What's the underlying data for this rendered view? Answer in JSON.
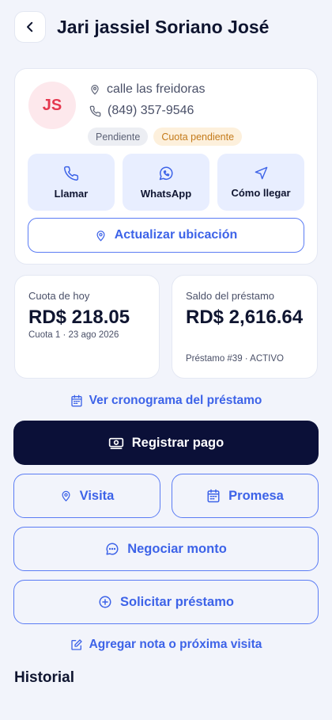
{
  "header": {
    "title": "Jari jassiel Soriano José"
  },
  "client": {
    "initials": "JS",
    "address": "calle las freidoras",
    "phone": "(849) 357-9546",
    "badges": [
      "Pendiente",
      "Cuota pendiente"
    ]
  },
  "actions": [
    {
      "label": "Llamar",
      "icon": "phone-icon"
    },
    {
      "label": "WhatsApp",
      "icon": "whatsapp-icon"
    },
    {
      "label": "Cómo llegar",
      "icon": "navigation-icon"
    }
  ],
  "update_location_label": "Actualizar ubicación",
  "today_installment": {
    "label": "Cuota de hoy",
    "value": "RD$ 218.05",
    "sub": "Cuota 1 · 23 ago 2026"
  },
  "loan_balance": {
    "label": "Saldo del préstamo",
    "value": "RD$ 2,616.64",
    "sub": "Préstamo #39 · ACTIVO"
  },
  "schedule_link": "Ver cronograma del préstamo",
  "buttons": {
    "register_payment": "Registrar pago",
    "visit": "Visita",
    "promise": "Promesa",
    "negotiate": "Negociar monto",
    "request_loan": "Solicitar préstamo"
  },
  "note_link": "Agregar nota o próxima visita",
  "history_title": "Historial",
  "colors": {
    "accent": "#3d63e8",
    "primary_button": "#0b1038",
    "avatar_bg": "#fde8ec",
    "avatar_text": "#e5384f",
    "badge_pending_bg": "#eceef3",
    "badge_due_bg": "#fdf0dc",
    "badge_due_text": "#c47a1a",
    "action_bg": "#e8eeff"
  }
}
